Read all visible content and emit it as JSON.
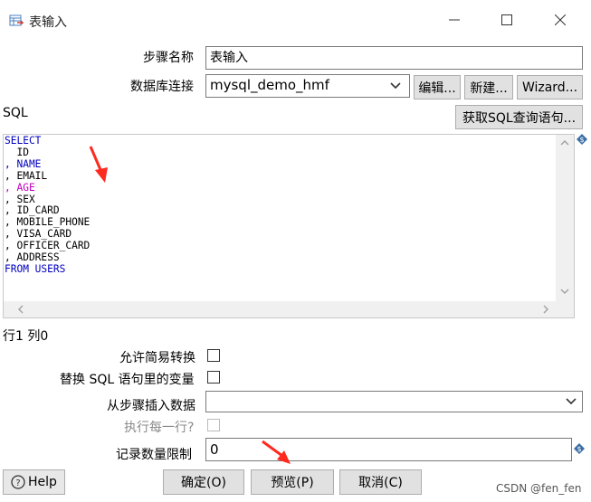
{
  "window": {
    "title": "表输入"
  },
  "form": {
    "step_name_label": "步骤名称",
    "step_name_value": "表输入",
    "db_conn_label": "数据库连接",
    "db_conn_value": "mysql_demo_hmf",
    "edit_btn": "编辑...",
    "new_btn": "新建...",
    "wizard_btn": "Wizard...",
    "sql_label": "SQL",
    "get_sql_btn": "获取SQL查询语句...",
    "sql_lines": [
      "SELECT",
      "  ID",
      ", NAME",
      ", EMAIL",
      ", AGE",
      ", SEX",
      ", ID_CARD",
      ", MOBILE_PHONE",
      ", VISA_CARD",
      ", OFFICER_CARD",
      ", ADDRESS",
      "FROM USERS"
    ],
    "cursor_pos": "行1 列0",
    "lazy_conversion_label": "允许简易转换",
    "replace_vars_label": "替换 SQL 语句里的变量",
    "insert_from_step_label": "从步骤插入数据",
    "insert_from_step_value": "",
    "execute_each_row_label": "执行每一行?",
    "limit_label": "记录数量限制",
    "limit_value": "0"
  },
  "footer": {
    "help_btn": "Help",
    "ok_btn": "确定(O)",
    "preview_btn": "预览(P)",
    "cancel_btn": "取消(C)"
  },
  "watermark": "CSDN @fen_fen",
  "colors": {
    "keyword": "#0000c0",
    "highlight_field": "#c000c0",
    "annotation_arrow": "#ff2a1f"
  }
}
